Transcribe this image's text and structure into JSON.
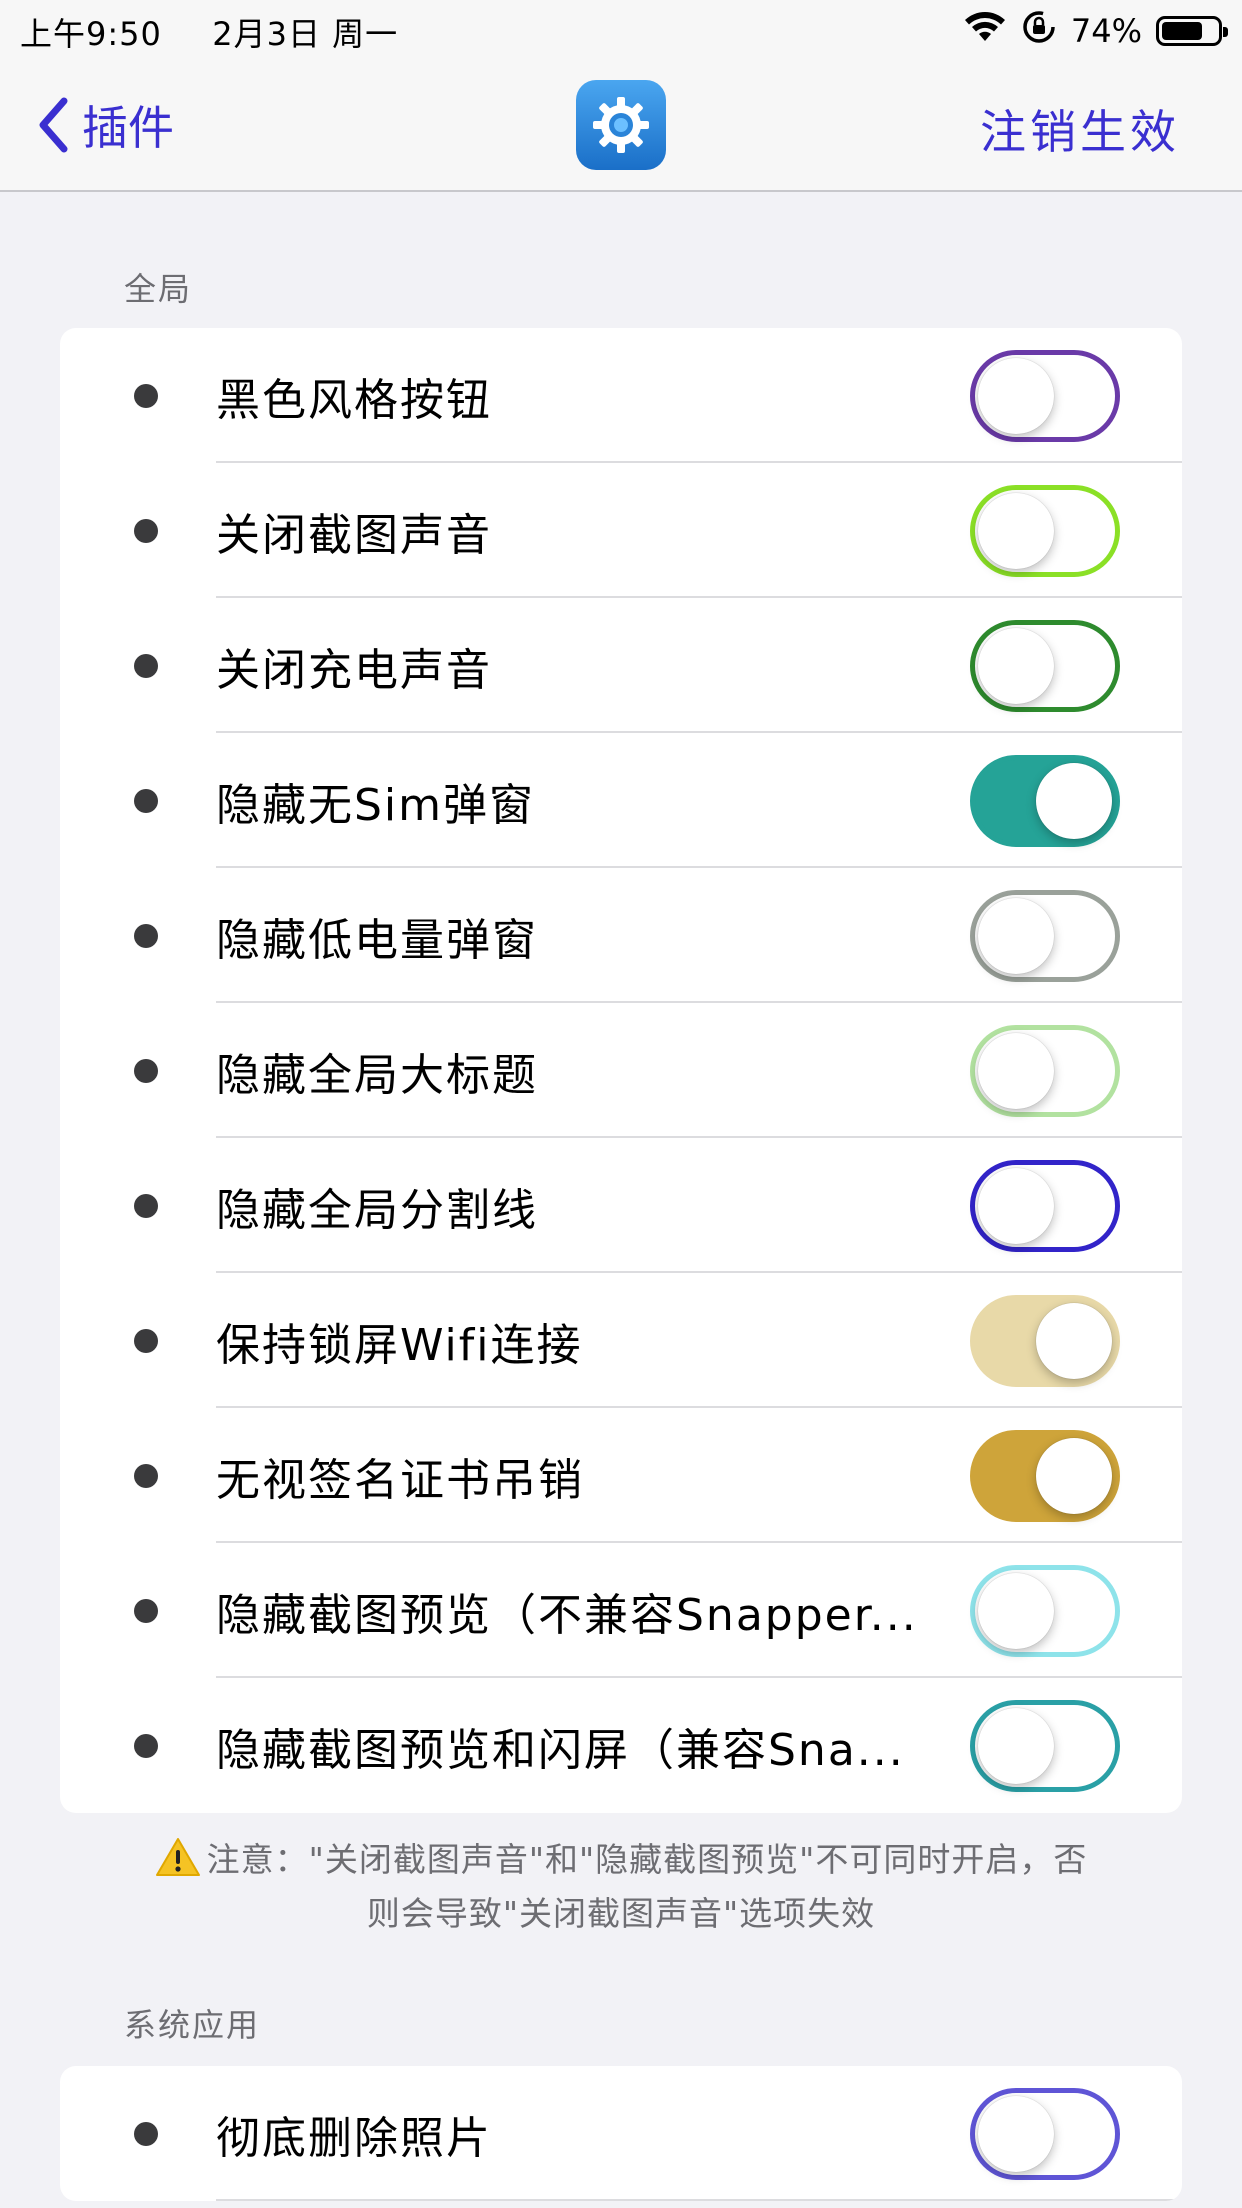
{
  "status_bar": {
    "time": "上午9:50",
    "date": "2月3日 周一",
    "battery_pct": "74%",
    "battery_level": 0.74
  },
  "nav": {
    "back_label": "插件",
    "action_label": "注销生效",
    "accent_color": "#3a2fd0"
  },
  "sections": [
    {
      "header": "全局",
      "items": [
        {
          "label": "黑色风格按钮",
          "on": false,
          "color": "#6a3aa8"
        },
        {
          "label": "关闭截图声音",
          "on": false,
          "color": "#8be026"
        },
        {
          "label": "关闭充电声音",
          "on": false,
          "color": "#2e8b2e"
        },
        {
          "label": "隐藏无Sim弹窗",
          "on": true,
          "color": "#25a397"
        },
        {
          "label": "隐藏低电量弹窗",
          "on": false,
          "color": "#9aa19a"
        },
        {
          "label": "隐藏全局大标题",
          "on": false,
          "color": "#b2e2a0"
        },
        {
          "label": "隐藏全局分割线",
          "on": false,
          "color": "#3224c9"
        },
        {
          "label": "保持锁屏Wifi连接",
          "on": true,
          "color": "#e8d9a8"
        },
        {
          "label": "无视签名证书吊销",
          "on": true,
          "color": "#cea43a"
        },
        {
          "label": "隐藏截图预览（不兼容Snapper...",
          "on": false,
          "color": "#8ee3ea"
        },
        {
          "label": "隐藏截图预览和闪屏（兼容Sna...",
          "on": false,
          "color": "#2aa0a6"
        }
      ]
    },
    {
      "header": "系统应用",
      "items": [
        {
          "label": "彻底删除照片",
          "on": false,
          "color": "#5f55d6"
        }
      ]
    }
  ],
  "warning": {
    "icon": "warning-icon",
    "line1": "注意：\"关闭截图声音\"和\"隐藏截图预览\"不可同时开启，否",
    "line2": "则会导致\"关闭截图声音\"选项失效"
  }
}
